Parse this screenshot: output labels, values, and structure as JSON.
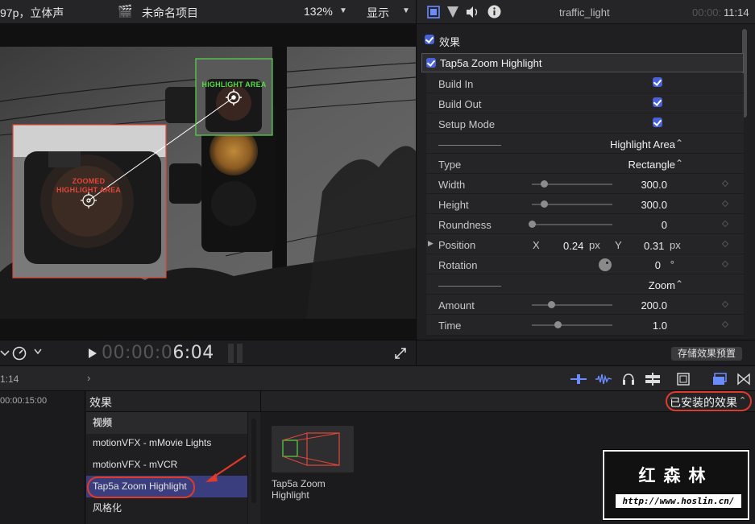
{
  "viewer": {
    "format_text": "97p，立体声",
    "project_name": "未命名项目",
    "zoom": "132%",
    "display_menu": "显示",
    "overlays": {
      "highlight_area_label": "HIGHLIGHT AREA",
      "zoomed_label_line1": "ZOOMED",
      "zoomed_label_line2": "HIGHLIGHT AREA"
    },
    "timecode_dim": "00:00:0",
    "timecode_bright": "6:04"
  },
  "inspector": {
    "clip_name": "traffic_light",
    "duration_dim": "00:00:",
    "duration_bright": "11:14",
    "effects_header": "效果",
    "effect_name": "Tap5a Zoom Highlight",
    "rows": {
      "build_in": "Build In",
      "build_out": "Build Out",
      "setup_mode": "Setup Mode",
      "divider1": "——————",
      "highlight_area": "Highlight Area",
      "type_label": "Type",
      "type_value": "Rectangle",
      "width_label": "Width",
      "width_value": "300.0",
      "height_label": "Height",
      "height_value": "300.0",
      "roundness_label": "Roundness",
      "roundness_value": "0",
      "position_label": "Position",
      "position_x_axis": "X",
      "position_x": "0.24",
      "position_x_unit": "px",
      "position_y_axis": "Y",
      "position_y": "0.31",
      "position_y_unit": "px",
      "rotation_label": "Rotation",
      "rotation_value": "0",
      "rotation_unit": "°",
      "divider2": "——————",
      "zoom": "Zoom",
      "amount_label": "Amount",
      "amount_value": "200.0",
      "time_label": "Time",
      "time_value": "1.0"
    },
    "slider_levels": {
      "width": 0.15,
      "height": 0.15,
      "roundness": 0.0,
      "amount": 0.24,
      "time": 0.32
    },
    "save_preset": "存储效果预置"
  },
  "timeline": {
    "left_time": "1:14",
    "ruler_time": "00:00:15:00"
  },
  "effects_browser": {
    "title": "效果",
    "installed_effects": "已安装的效果",
    "category_header": "视频",
    "items": [
      "motionVFX - mMovie Lights",
      "motionVFX - mVCR",
      "Tap5a Zoom Highlight",
      "风格化"
    ],
    "selected_index": 2,
    "thumbnail_caption": "Tap5a Zoom Highlight"
  },
  "watermark": {
    "title": "红森林",
    "url": "http://www.hoslin.cn/"
  },
  "colors": {
    "accent_blue": "#4a62d8",
    "annotation_red": "#e03a2a",
    "highlight_green": "#58d84a",
    "zoom_red": "#e3463a"
  }
}
